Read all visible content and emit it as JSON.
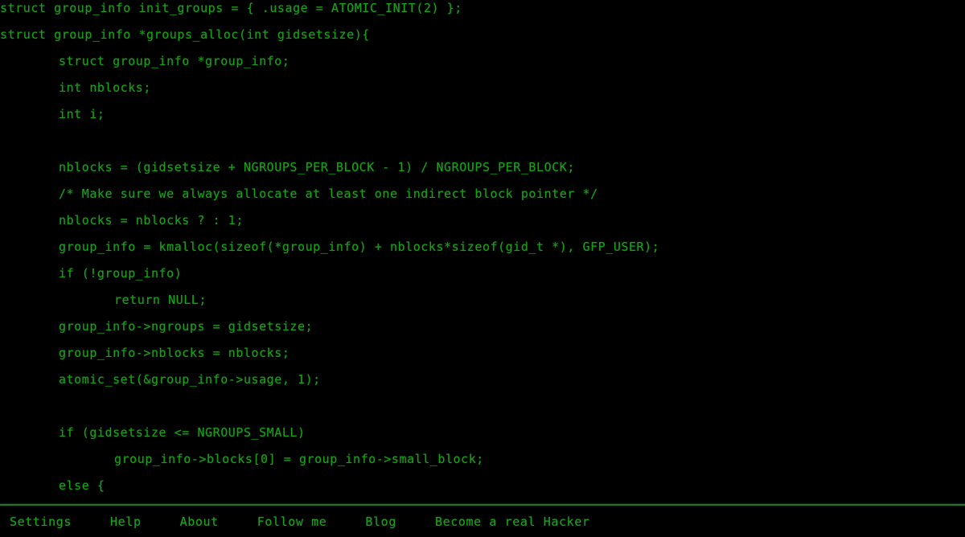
{
  "page": {
    "title": "Hacker Typer",
    "background_color": "#000000",
    "code_text_color": "#16a116",
    "accent_color": "#1f7a1f",
    "footer_text_color": "#19a319"
  },
  "code": {
    "language": "c",
    "lines": [
      {
        "indent": 0,
        "text": "struct group_info init_groups = { .usage = ATOMIC_INIT(2) };"
      },
      {
        "indent": 0,
        "text": "struct group_info *groups_alloc(int gidsetsize){"
      },
      {
        "indent": 1,
        "text": "struct group_info *group_info;"
      },
      {
        "indent": 1,
        "text": "int nblocks;"
      },
      {
        "indent": 1,
        "text": "int i;"
      },
      {
        "indent": 0,
        "text": ""
      },
      {
        "indent": 1,
        "text": "nblocks = (gidsetsize + NGROUPS_PER_BLOCK - 1) / NGROUPS_PER_BLOCK;"
      },
      {
        "indent": 1,
        "text": "/* Make sure we always allocate at least one indirect block pointer */"
      },
      {
        "indent": 1,
        "text": "nblocks = nblocks ? : 1;"
      },
      {
        "indent": 1,
        "text": "group_info = kmalloc(sizeof(*group_info) + nblocks*sizeof(gid_t *), GFP_USER);"
      },
      {
        "indent": 1,
        "text": "if (!group_info)"
      },
      {
        "indent": 2,
        "text": "return NULL;"
      },
      {
        "indent": 1,
        "text": "group_info->ngroups = gidsetsize;"
      },
      {
        "indent": 1,
        "text": "group_info->nblocks = nblocks;"
      },
      {
        "indent": 1,
        "text": "atomic_set(&group_info->usage, 1);"
      },
      {
        "indent": 0,
        "text": ""
      },
      {
        "indent": 1,
        "text": "if (gidsetsize <= NGROUPS_SMALL)"
      },
      {
        "indent": 2,
        "text": "group_info->blocks[0] = group_info->small_block;"
      },
      {
        "indent": 1,
        "text": "else {"
      }
    ]
  },
  "footer": {
    "links": [
      {
        "label": "Settings",
        "name": "settings"
      },
      {
        "label": "Help",
        "name": "help"
      },
      {
        "label": "About",
        "name": "about"
      },
      {
        "label": "Follow me",
        "name": "follow-me"
      },
      {
        "label": "Blog",
        "name": "blog"
      },
      {
        "label": "Become a real Hacker",
        "name": "become-a-real-hacker"
      }
    ]
  }
}
